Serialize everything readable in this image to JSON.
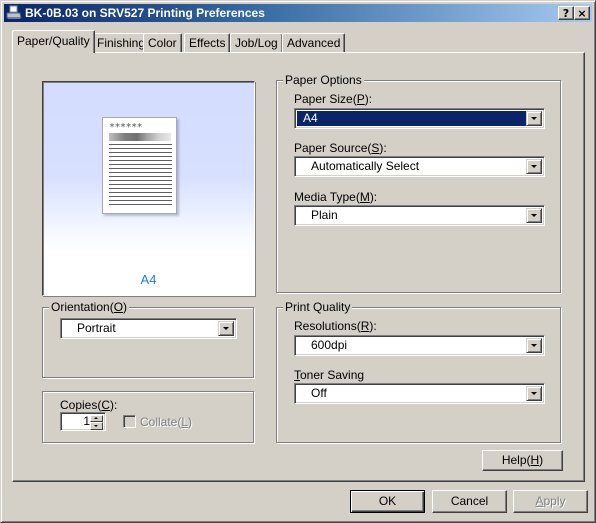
{
  "window": {
    "title": "BK-0B.03 on SRV527 Printing Preferences",
    "help_button": "?",
    "close_button": "×"
  },
  "tabs": [
    {
      "label": "Paper/Quality",
      "active": true
    },
    {
      "label": "Finishing",
      "active": false
    },
    {
      "label": "Color",
      "active": false
    },
    {
      "label": "Effects",
      "active": false
    },
    {
      "label": "Job/Log",
      "active": false
    },
    {
      "label": "Advanced",
      "active": false
    }
  ],
  "preview": {
    "paper_size_label": "A4",
    "header_stars": "******"
  },
  "orientation": {
    "group_label_pre": "Orientation(",
    "group_label_key": "O",
    "group_label_post": ")",
    "value": "Portrait"
  },
  "copies": {
    "label_pre": "Copies(",
    "label_key": "C",
    "label_post": "):",
    "value": "1",
    "collate_pre": "Collate(",
    "collate_key": "L",
    "collate_post": ")",
    "collate_checked": false,
    "collate_enabled": false
  },
  "paper_options": {
    "group_label": "Paper Options",
    "paper_size": {
      "label_pre": "Paper Size(",
      "label_key": "P",
      "label_post": "):",
      "value": "A4"
    },
    "paper_source": {
      "label_pre": "Paper Source(",
      "label_key": "S",
      "label_post": "):",
      "value": "Automatically Select"
    },
    "media_type": {
      "label_pre": "Media Type(",
      "label_key": "M",
      "label_post": "):",
      "value": "Plain"
    }
  },
  "print_quality": {
    "group_label": "Print Quality",
    "resolutions": {
      "label_pre": "Resolutions(",
      "label_key": "R",
      "label_post": "):",
      "value": "600dpi"
    },
    "toner_saving": {
      "label_key": "T",
      "label_rest": "oner Saving",
      "value": "Off"
    }
  },
  "buttons": {
    "help_pre": "Help(",
    "help_key": "H",
    "help_post": ")",
    "ok": "OK",
    "cancel": "Cancel",
    "apply_key": "A",
    "apply_rest": "pply"
  },
  "colors": {
    "title_gradient_start": "#0a246a",
    "title_gradient_end": "#a6caf0",
    "selection": "#0a246a",
    "preview_label": "#1f7fd4",
    "face": "#d4d0c8"
  }
}
